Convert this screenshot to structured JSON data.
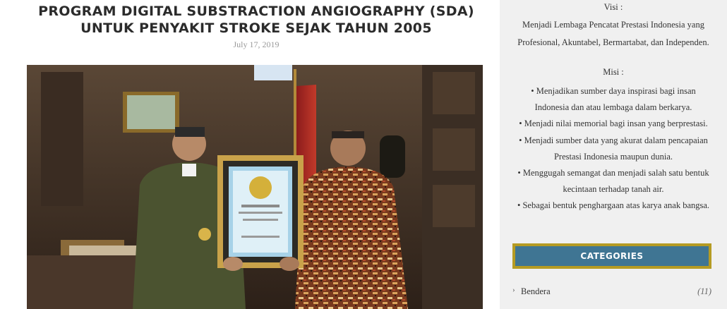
{
  "post": {
    "title_line1": "PROGRAM DIGITAL SUBSTRACTION ANGIOGRAPHY (SDA)",
    "title_line2": "UNTUK PENYAKIT STROKE SEJAK TAHUN 2005",
    "date": "July 17, 2019",
    "image_alt": "Penyerahan piagam penghargaan"
  },
  "sidebar": {
    "visi_title": "Visi :",
    "visi_lines": [
      "Menjadi Lembaga Pencatat Prestasi Indonesia yang",
      "Profesional, Akuntabel, Bermartabat, dan Independen."
    ],
    "misi_title": "Misi :",
    "misi_lines": [
      "• Menjadikan sumber daya inspirasi bagi insan",
      "Indonesia dan atau lembaga dalam berkarya.",
      "• Menjadi nilai memorial bagi insan yang berprestasi.",
      "• Menjadi sumber data yang akurat dalam pencapaian",
      "Prestasi Indonesia maupun dunia.",
      "• Menggugah semangat dan menjadi salah satu bentuk",
      "kecintaan terhadap tanah air.",
      "• Sebagai bentuk penghargaan atas karya anak bangsa."
    ],
    "categories_title": "CATEGORIES",
    "categories": [
      {
        "label": "Bendera",
        "count": "(11)"
      }
    ]
  },
  "colors": {
    "category_header_bg": "#3f7593",
    "category_header_border": "#b59b23",
    "sidebar_bg": "#f0f0f0"
  },
  "icons": {
    "category_bullet": "chevron-right-icon"
  }
}
